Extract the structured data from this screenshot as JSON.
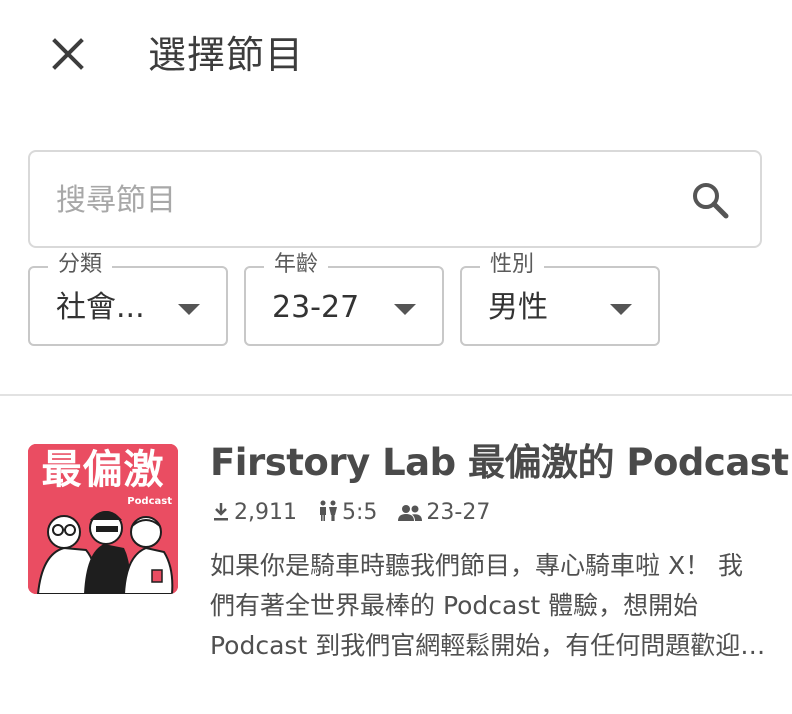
{
  "header": {
    "title": "選擇節目",
    "close_icon": "close-icon"
  },
  "search": {
    "placeholder": "搜尋節目",
    "value": "",
    "icon": "search-icon"
  },
  "filters": [
    {
      "label": "分類",
      "value": "社會..."
    },
    {
      "label": "年齡",
      "value": "23-27"
    },
    {
      "label": "性別",
      "value": "男性"
    }
  ],
  "podcast": {
    "cover_title": "最偏激",
    "cover_subtitle": "Podcast",
    "title": "Firstory Lab 最偏激的 Podcast",
    "downloads": "2,911",
    "gender_ratio": "5:5",
    "age_range": "23-27",
    "description": "如果你是騎車時聽我們節目，專心騎車啦 X！ 我們有著全世界最棒的 Podcast 體驗，想開始 Podcast 到我們官網輕鬆開始，有任何問題歡迎聯絡我們"
  },
  "colors": {
    "cover_bg": "#ea4d62",
    "text": "#424242",
    "border": "#d9d9d9"
  }
}
